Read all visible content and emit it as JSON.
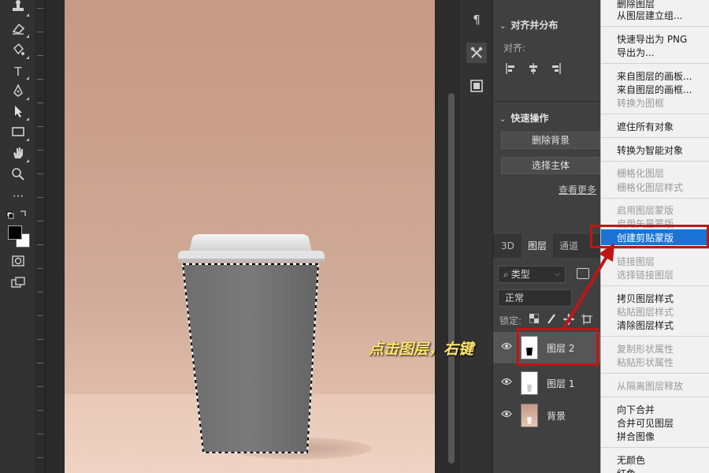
{
  "toolbar": {
    "tools": [
      "stamp-tool",
      "eraser-tool",
      "paint-bucket-tool",
      "type-tool",
      "pen-tool",
      "path-selection-tool",
      "rectangle-tool",
      "hand-tool",
      "zoom-tool",
      "more-tools",
      "default-colors",
      "swap-colors",
      "foreground-color",
      "background-color",
      "quick-mask",
      "screen-mode"
    ],
    "type_glyph": "T",
    "more_glyph": "···",
    "foreground_color": "#000000",
    "background_color": "#ffffff"
  },
  "icon_strip": {
    "paragraph_glyph": "¶"
  },
  "align_panel": {
    "title": "对齐并分布",
    "align_label": "对齐:"
  },
  "quick_actions": {
    "title": "快速操作",
    "remove_bg": "删除背景",
    "select_subject": "选择主体",
    "see_more": "查看更多"
  },
  "layers_panel": {
    "tabs": [
      "3D",
      "图层",
      "通道"
    ],
    "active_tab": "图层",
    "filter_label": "类型",
    "blend_mode": "正常",
    "lock_label": "锁定:",
    "layers": [
      {
        "name": "图层 2",
        "selected": true
      },
      {
        "name": "图层 1",
        "selected": false
      },
      {
        "name": "背景",
        "selected": false
      }
    ]
  },
  "context_menu": {
    "items": [
      {
        "label": "删除图层",
        "enabled": true
      },
      {
        "label": "从图层建立组...",
        "enabled": true
      },
      {
        "label": "快速导出为 PNG",
        "enabled": true
      },
      {
        "label": "导出为...",
        "enabled": true
      },
      {
        "label": "来自图层的画板...",
        "enabled": true
      },
      {
        "label": "来自图层的画框...",
        "enabled": true
      },
      {
        "label": "转换为图框",
        "enabled": false
      },
      {
        "label": "遮住所有对象",
        "enabled": true
      },
      {
        "label": "转换为智能对象",
        "enabled": true
      },
      {
        "label": "栅格化图层",
        "enabled": false
      },
      {
        "label": "栅格化图层样式",
        "enabled": false
      },
      {
        "label": "启用图层蒙版",
        "enabled": false
      },
      {
        "label": "启用矢量蒙版",
        "enabled": false
      },
      {
        "label": "创建剪贴蒙版",
        "enabled": true,
        "highlighted": true
      },
      {
        "label": "链接图层",
        "enabled": false
      },
      {
        "label": "选择链接图层",
        "enabled": false
      },
      {
        "label": "拷贝图层样式",
        "enabled": true
      },
      {
        "label": "粘贴图层样式",
        "enabled": false
      },
      {
        "label": "清除图层样式",
        "enabled": true
      },
      {
        "label": "复制形状属性",
        "enabled": false
      },
      {
        "label": "粘贴形状属性",
        "enabled": false
      },
      {
        "label": "从隔离图层释放",
        "enabled": false
      },
      {
        "label": "向下合并",
        "enabled": true
      },
      {
        "label": "合并可见图层",
        "enabled": true
      },
      {
        "label": "拼合图像",
        "enabled": true
      },
      {
        "label": "无颜色",
        "enabled": true
      },
      {
        "label": "红色",
        "enabled": true
      }
    ]
  },
  "annotation": {
    "text": "点击图层，右键",
    "color": "#ffe66d",
    "box_color": "#c01515"
  },
  "colors": {
    "highlight": "#1a74d4"
  }
}
